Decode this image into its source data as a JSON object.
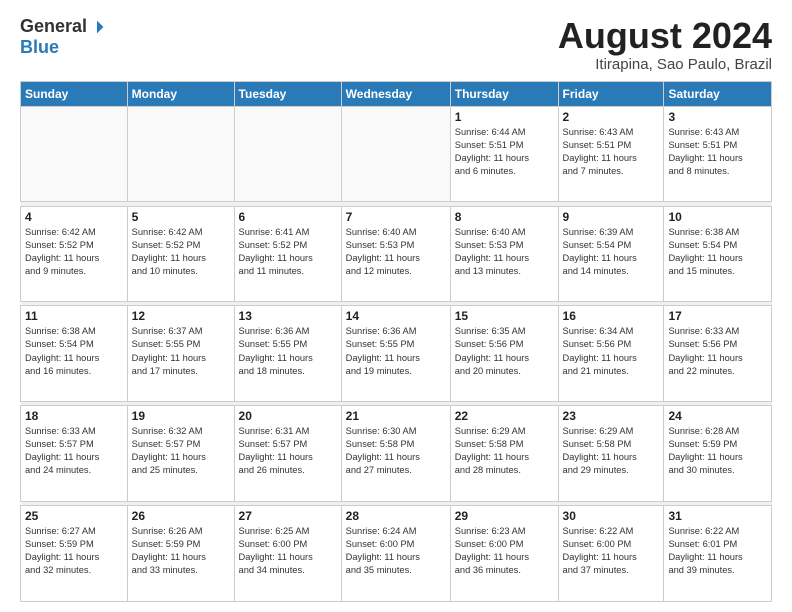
{
  "logo": {
    "general": "General",
    "blue": "Blue"
  },
  "title": "August 2024",
  "subtitle": "Itirapina, Sao Paulo, Brazil",
  "weekdays": [
    "Sunday",
    "Monday",
    "Tuesday",
    "Wednesday",
    "Thursday",
    "Friday",
    "Saturday"
  ],
  "weeks": [
    [
      {
        "day": "",
        "info": ""
      },
      {
        "day": "",
        "info": ""
      },
      {
        "day": "",
        "info": ""
      },
      {
        "day": "",
        "info": ""
      },
      {
        "day": "1",
        "info": "Sunrise: 6:44 AM\nSunset: 5:51 PM\nDaylight: 11 hours\nand 6 minutes."
      },
      {
        "day": "2",
        "info": "Sunrise: 6:43 AM\nSunset: 5:51 PM\nDaylight: 11 hours\nand 7 minutes."
      },
      {
        "day": "3",
        "info": "Sunrise: 6:43 AM\nSunset: 5:51 PM\nDaylight: 11 hours\nand 8 minutes."
      }
    ],
    [
      {
        "day": "4",
        "info": "Sunrise: 6:42 AM\nSunset: 5:52 PM\nDaylight: 11 hours\nand 9 minutes."
      },
      {
        "day": "5",
        "info": "Sunrise: 6:42 AM\nSunset: 5:52 PM\nDaylight: 11 hours\nand 10 minutes."
      },
      {
        "day": "6",
        "info": "Sunrise: 6:41 AM\nSunset: 5:52 PM\nDaylight: 11 hours\nand 11 minutes."
      },
      {
        "day": "7",
        "info": "Sunrise: 6:40 AM\nSunset: 5:53 PM\nDaylight: 11 hours\nand 12 minutes."
      },
      {
        "day": "8",
        "info": "Sunrise: 6:40 AM\nSunset: 5:53 PM\nDaylight: 11 hours\nand 13 minutes."
      },
      {
        "day": "9",
        "info": "Sunrise: 6:39 AM\nSunset: 5:54 PM\nDaylight: 11 hours\nand 14 minutes."
      },
      {
        "day": "10",
        "info": "Sunrise: 6:38 AM\nSunset: 5:54 PM\nDaylight: 11 hours\nand 15 minutes."
      }
    ],
    [
      {
        "day": "11",
        "info": "Sunrise: 6:38 AM\nSunset: 5:54 PM\nDaylight: 11 hours\nand 16 minutes."
      },
      {
        "day": "12",
        "info": "Sunrise: 6:37 AM\nSunset: 5:55 PM\nDaylight: 11 hours\nand 17 minutes."
      },
      {
        "day": "13",
        "info": "Sunrise: 6:36 AM\nSunset: 5:55 PM\nDaylight: 11 hours\nand 18 minutes."
      },
      {
        "day": "14",
        "info": "Sunrise: 6:36 AM\nSunset: 5:55 PM\nDaylight: 11 hours\nand 19 minutes."
      },
      {
        "day": "15",
        "info": "Sunrise: 6:35 AM\nSunset: 5:56 PM\nDaylight: 11 hours\nand 20 minutes."
      },
      {
        "day": "16",
        "info": "Sunrise: 6:34 AM\nSunset: 5:56 PM\nDaylight: 11 hours\nand 21 minutes."
      },
      {
        "day": "17",
        "info": "Sunrise: 6:33 AM\nSunset: 5:56 PM\nDaylight: 11 hours\nand 22 minutes."
      }
    ],
    [
      {
        "day": "18",
        "info": "Sunrise: 6:33 AM\nSunset: 5:57 PM\nDaylight: 11 hours\nand 24 minutes."
      },
      {
        "day": "19",
        "info": "Sunrise: 6:32 AM\nSunset: 5:57 PM\nDaylight: 11 hours\nand 25 minutes."
      },
      {
        "day": "20",
        "info": "Sunrise: 6:31 AM\nSunset: 5:57 PM\nDaylight: 11 hours\nand 26 minutes."
      },
      {
        "day": "21",
        "info": "Sunrise: 6:30 AM\nSunset: 5:58 PM\nDaylight: 11 hours\nand 27 minutes."
      },
      {
        "day": "22",
        "info": "Sunrise: 6:29 AM\nSunset: 5:58 PM\nDaylight: 11 hours\nand 28 minutes."
      },
      {
        "day": "23",
        "info": "Sunrise: 6:29 AM\nSunset: 5:58 PM\nDaylight: 11 hours\nand 29 minutes."
      },
      {
        "day": "24",
        "info": "Sunrise: 6:28 AM\nSunset: 5:59 PM\nDaylight: 11 hours\nand 30 minutes."
      }
    ],
    [
      {
        "day": "25",
        "info": "Sunrise: 6:27 AM\nSunset: 5:59 PM\nDaylight: 11 hours\nand 32 minutes."
      },
      {
        "day": "26",
        "info": "Sunrise: 6:26 AM\nSunset: 5:59 PM\nDaylight: 11 hours\nand 33 minutes."
      },
      {
        "day": "27",
        "info": "Sunrise: 6:25 AM\nSunset: 6:00 PM\nDaylight: 11 hours\nand 34 minutes."
      },
      {
        "day": "28",
        "info": "Sunrise: 6:24 AM\nSunset: 6:00 PM\nDaylight: 11 hours\nand 35 minutes."
      },
      {
        "day": "29",
        "info": "Sunrise: 6:23 AM\nSunset: 6:00 PM\nDaylight: 11 hours\nand 36 minutes."
      },
      {
        "day": "30",
        "info": "Sunrise: 6:22 AM\nSunset: 6:00 PM\nDaylight: 11 hours\nand 37 minutes."
      },
      {
        "day": "31",
        "info": "Sunrise: 6:22 AM\nSunset: 6:01 PM\nDaylight: 11 hours\nand 39 minutes."
      }
    ]
  ]
}
